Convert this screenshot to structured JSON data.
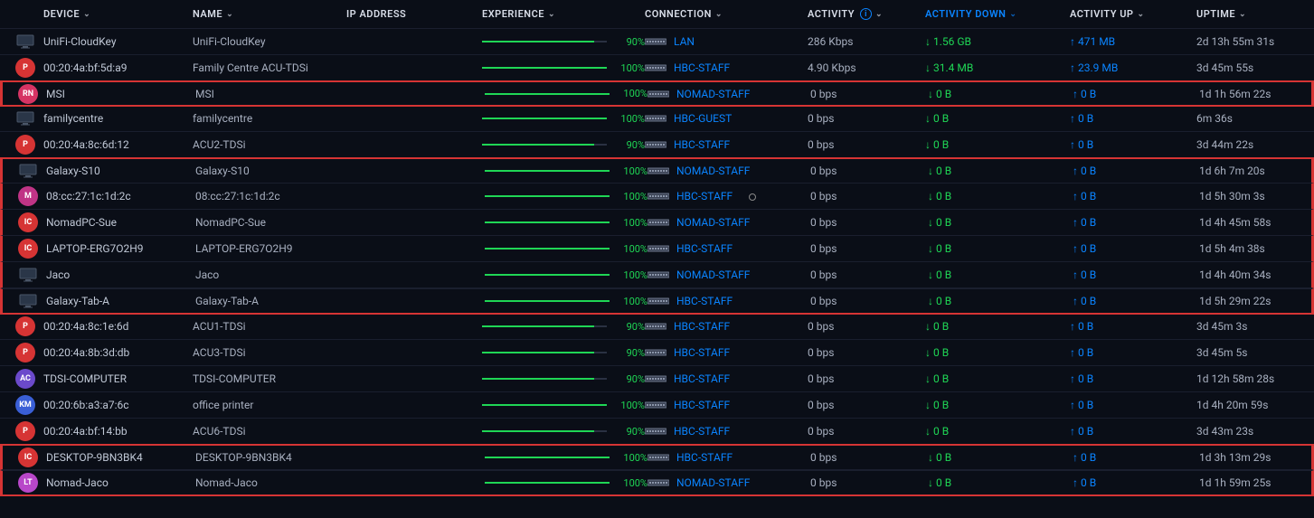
{
  "columns": {
    "device": "DEVICE",
    "name": "NAME",
    "ip": "IP ADDRESS",
    "experience": "EXPERIENCE",
    "connection": "CONNECTION",
    "activity": "ACTIVITY",
    "activity_down": "ACTIVITY DOWN",
    "activity_up": "ACTIVITY UP",
    "uptime": "UPTIME"
  },
  "colors": {
    "P": "#d63434",
    "RN": "#d63464",
    "M": "#c03486",
    "IC": "#d63434",
    "AC": "#6b4acb",
    "KM": "#3a5fd6",
    "LT": "#b847c9"
  },
  "rows": [
    {
      "icon": "monitor",
      "badge": "",
      "device": "UniFi-CloudKey",
      "name": "UniFi-CloudKey",
      "exp": 90,
      "conn": "LAN",
      "activity": "286 Kbps",
      "down": "1.56 GB",
      "up": "471 MB",
      "uptime": "2d 13h 55m 31s",
      "hl": ""
    },
    {
      "icon": "badge",
      "badge": "P",
      "device": "00:20:4a:bf:5d:a9",
      "name": "Family Centre ACU-TDSi",
      "exp": 100,
      "conn": "HBC-STAFF",
      "activity": "4.90 Kbps",
      "down": "31.4 MB",
      "up": "23.9 MB",
      "uptime": "3d 45m 55s",
      "hl": ""
    },
    {
      "icon": "badge",
      "badge": "RN",
      "device": "MSI",
      "name": "MSI",
      "exp": 100,
      "conn": "NOMAD-STAFF",
      "activity": "0 bps",
      "down": "0 B",
      "up": "0 B",
      "uptime": "1d 1h 56m 22s",
      "hl": "single"
    },
    {
      "icon": "monitor",
      "badge": "",
      "device": "familycentre",
      "name": "familycentre",
      "exp": 100,
      "conn": "HBC-GUEST",
      "activity": "0 bps",
      "down": "0 B",
      "up": "0 B",
      "uptime": "6m 36s",
      "hl": ""
    },
    {
      "icon": "badge",
      "badge": "P",
      "device": "00:20:4a:8c:6d:12",
      "name": "ACU2-TDSi",
      "exp": 90,
      "conn": "HBC-STAFF",
      "activity": "0 bps",
      "down": "0 B",
      "up": "0 B",
      "uptime": "3d 44m 22s",
      "hl": ""
    },
    {
      "icon": "monitor",
      "badge": "",
      "device": "Galaxy-S10",
      "name": "Galaxy-S10",
      "exp": 100,
      "conn": "NOMAD-STAFF",
      "activity": "0 bps",
      "down": "0 B",
      "up": "0 B",
      "uptime": "1d 6h 7m 20s",
      "hl": "top"
    },
    {
      "icon": "badge",
      "badge": "M",
      "device": "08:cc:27:1c:1d:2c",
      "name": "08:cc:27:1c:1d:2c",
      "exp": 100,
      "conn": "HBC-STAFF",
      "activity": "0 bps",
      "down": "0 B",
      "up": "0 B",
      "uptime": "1d 5h 30m 3s",
      "hl": "mid",
      "cursor": true
    },
    {
      "icon": "badge",
      "badge": "IC",
      "device": "NomadPC-Sue",
      "name": "NomadPC-Sue",
      "exp": 100,
      "conn": "NOMAD-STAFF",
      "activity": "0 bps",
      "down": "0 B",
      "up": "0 B",
      "uptime": "1d 4h 45m 58s",
      "hl": "mid"
    },
    {
      "icon": "badge",
      "badge": "IC",
      "device": "LAPTOP-ERG7O2H9",
      "name": "LAPTOP-ERG7O2H9",
      "exp": 100,
      "conn": "HBC-STAFF",
      "activity": "0 bps",
      "down": "0 B",
      "up": "0 B",
      "uptime": "1d 5h 4m 38s",
      "hl": "mid"
    },
    {
      "icon": "monitor",
      "badge": "",
      "device": "Jaco",
      "name": "Jaco",
      "exp": 100,
      "conn": "NOMAD-STAFF",
      "activity": "0 bps",
      "down": "0 B",
      "up": "0 B",
      "uptime": "1d 4h 40m 34s",
      "hl": "mid"
    },
    {
      "icon": "monitor",
      "badge": "",
      "device": "Galaxy-Tab-A",
      "name": "Galaxy-Tab-A",
      "exp": 100,
      "conn": "HBC-STAFF",
      "activity": "0 bps",
      "down": "0 B",
      "up": "0 B",
      "uptime": "1d 5h 29m 22s",
      "hl": "bot"
    },
    {
      "icon": "badge",
      "badge": "P",
      "device": "00:20:4a:8c:1e:6d",
      "name": "ACU1-TDSi",
      "exp": 90,
      "conn": "HBC-STAFF",
      "activity": "0 bps",
      "down": "0 B",
      "up": "0 B",
      "uptime": "3d 45m 3s",
      "hl": ""
    },
    {
      "icon": "badge",
      "badge": "P",
      "device": "00:20:4a:8b:3d:db",
      "name": "ACU3-TDSi",
      "exp": 90,
      "conn": "HBC-STAFF",
      "activity": "0 bps",
      "down": "0 B",
      "up": "0 B",
      "uptime": "3d 45m 5s",
      "hl": ""
    },
    {
      "icon": "badge",
      "badge": "AC",
      "device": "TDSI-COMPUTER",
      "name": "TDSI-COMPUTER",
      "exp": 90,
      "conn": "HBC-STAFF",
      "activity": "0 bps",
      "down": "0 B",
      "up": "0 B",
      "uptime": "1d 12h 58m 28s",
      "hl": ""
    },
    {
      "icon": "badge",
      "badge": "KM",
      "device": "00:20:6b:a3:a7:6c",
      "name": "office printer",
      "exp": 100,
      "conn": "HBC-STAFF",
      "activity": "0 bps",
      "down": "0 B",
      "up": "0 B",
      "uptime": "1d 4h 20m 59s",
      "hl": ""
    },
    {
      "icon": "badge",
      "badge": "P",
      "device": "00:20:4a:bf:14:bb",
      "name": "ACU6-TDSi",
      "exp": 90,
      "conn": "HBC-STAFF",
      "activity": "0 bps",
      "down": "0 B",
      "up": "0 B",
      "uptime": "3d 43m 23s",
      "hl": ""
    },
    {
      "icon": "badge",
      "badge": "IC",
      "device": "DESKTOP-9BN3BK4",
      "name": "DESKTOP-9BN3BK4",
      "exp": 100,
      "conn": "HBC-STAFF",
      "activity": "0 bps",
      "down": "0 B",
      "up": "0 B",
      "uptime": "1d 3h 13m 29s",
      "hl": "top"
    },
    {
      "icon": "badge",
      "badge": "LT",
      "device": "Nomad-Jaco",
      "name": "Nomad-Jaco",
      "exp": 100,
      "conn": "NOMAD-STAFF",
      "activity": "0 bps",
      "down": "0 B",
      "up": "0 B",
      "uptime": "1d 1h 59m 25s",
      "hl": "bot"
    }
  ]
}
